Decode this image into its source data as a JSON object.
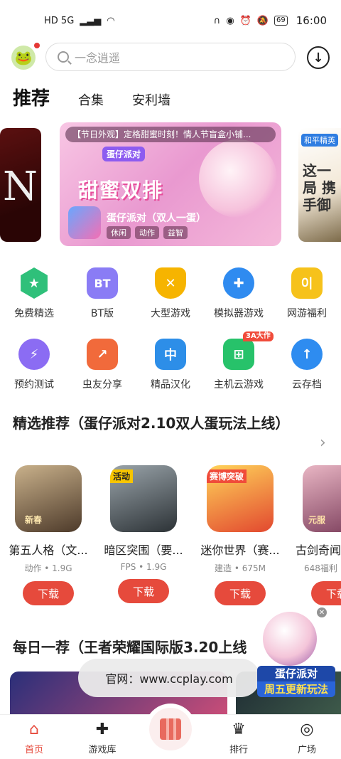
{
  "status_bar": {
    "left": "HD 5G",
    "battery": "69",
    "time": "16:00"
  },
  "search": {
    "placeholder": "一念逍遥"
  },
  "tabs": [
    "推荐",
    "合集",
    "安利墙"
  ],
  "carousel": {
    "caption": "【节日外观】定格甜蜜时刻！情人节盲盒小铺...",
    "logo_text": "蛋仔派对",
    "headline": "甜蜜双排",
    "game_title": "蛋仔派对（双人一蛋）",
    "tags": [
      "休闲",
      "动作",
      "益智"
    ],
    "left_card_letter": "N",
    "right_card_top": "和平精英",
    "right_card_text": "这一局 携手御"
  },
  "categories": [
    {
      "label": "免费精选",
      "icon": "star-icon",
      "glyph": "★",
      "color": "#2fc07a"
    },
    {
      "label": "BT版",
      "icon": "bt-icon",
      "glyph": "BT",
      "color": "#8a7cf5"
    },
    {
      "label": "大型游戏",
      "icon": "sword-icon",
      "glyph": "✕",
      "color": "#f6b400"
    },
    {
      "label": "模拟器游戏",
      "icon": "gamepad-icon",
      "glyph": "⌘",
      "color": "#2f8bf0"
    },
    {
      "label": "网游福利",
      "icon": "gift-icon",
      "glyph": "이",
      "color": "#f6c21b"
    },
    {
      "label": "预约测试",
      "icon": "clock-icon",
      "glyph": "⚡",
      "color": "#8b6cf3"
    },
    {
      "label": "虫友分享",
      "icon": "share-icon",
      "glyph": "↗",
      "color": "#f16a3b"
    },
    {
      "label": "精品汉化",
      "icon": "translate-icon",
      "glyph": "中",
      "color": "#2d8ee8"
    },
    {
      "label": "主机云游戏",
      "icon": "cloud-controller-icon",
      "glyph": "⌂",
      "color": "#27c26a",
      "badge": "3A大作"
    },
    {
      "label": "云存档",
      "icon": "cloud-upload-icon",
      "glyph": "↑",
      "color": "#2e8cf0"
    }
  ],
  "section1": {
    "title": "精选推荐（蛋仔派对2.10双人蛋玩法上线）"
  },
  "apps": [
    {
      "name": "第五人格（文...",
      "genre": "动作",
      "size": "1.9G",
      "tag": "新春",
      "download": "下载",
      "bg": "linear-gradient(160deg,#c9b18b,#4d3a2a)"
    },
    {
      "name": "暗区突围（要...",
      "genre": "FPS",
      "size": "1.9G",
      "tag": "活动",
      "download": "下载",
      "bg": "linear-gradient(160deg,#9aa4aa,#2c3236)"
    },
    {
      "name": "迷你世界（赛...",
      "genre": "建造",
      "size": "675M",
      "tag": "赛博突破",
      "download": "下载",
      "bg": "linear-gradient(160deg,#ffd45a,#e2482f)"
    },
    {
      "name": "古剑奇闻",
      "genre": "648福利",
      "size": "",
      "tag": "元服",
      "download": "下载",
      "bg": "linear-gradient(160deg,#e9b6c4,#7a3c5a)"
    }
  ],
  "section2": {
    "title": "每日一荐（王者荣耀国际版3.20上线"
  },
  "toast": "官网：www.ccplay.com",
  "float_ad": {
    "line1": "蛋仔派对",
    "line2": "周五更新玩法"
  },
  "nav": [
    {
      "label": "首页",
      "icon": "home-icon",
      "glyph": "⌂"
    },
    {
      "label": "游戏库",
      "icon": "gamepad-icon",
      "glyph": "✚"
    },
    {
      "label": "排行",
      "icon": "trophy-icon",
      "glyph": "♛"
    },
    {
      "label": "广场",
      "icon": "plaza-icon",
      "glyph": "◎"
    }
  ]
}
